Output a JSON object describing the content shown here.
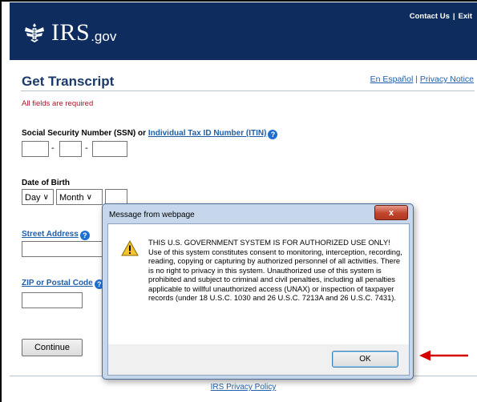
{
  "header": {
    "brand": "IRS",
    "tld": ".gov",
    "links": [
      "Contact Us",
      "Exit"
    ],
    "separator": "|"
  },
  "page": {
    "title": "Get Transcript",
    "lang_link": "En Español",
    "lang_separator": "|",
    "privacy_link": "Privacy Notice",
    "required_note": "All fields are required"
  },
  "form": {
    "ssn_label_prefix": "Social Security Number (SSN) or ",
    "ssn_label_link": "Individual Tax ID Number (ITIN)",
    "ssn_separator": "-",
    "dob_label": "Date of Birth",
    "dob_day": "Day",
    "dob_month": "Month",
    "street_label": "Street Address",
    "zip_label": "ZIP or Postal Code",
    "continue_label": "Continue",
    "help_glyph": "?"
  },
  "footer": {
    "policy_link": "IRS Privacy Policy"
  },
  "dialog": {
    "title": "Message from webpage",
    "close_glyph": "x",
    "heading": "THIS U.S. GOVERNMENT SYSTEM IS FOR AUTHORIZED USE ONLY!",
    "body": "Use of this system constitutes consent to monitoring, interception, recording, reading, copying or capturing by authorized personnel of all activities.  There is no right to privacy in this system.  Unauthorized use of this system is prohibited and subject to criminal and civil penalties, including all penalties applicable to willful unauthorized access (UNAX) or inspection of taxpayer records (under 18 U.S.C. 1030 and 26 U.S.C. 7213A and 26 U.S.C. 7431).",
    "ok_label": "OK"
  },
  "colors": {
    "header_bg": "#0e2d5e",
    "link": "#1f5fa9",
    "required": "#b2142a",
    "annotation_arrow": "#d40000"
  },
  "icons": [
    "irs-eagle-icon",
    "help-icon",
    "warning-icon",
    "close-icon",
    "red-arrow-icon"
  ]
}
